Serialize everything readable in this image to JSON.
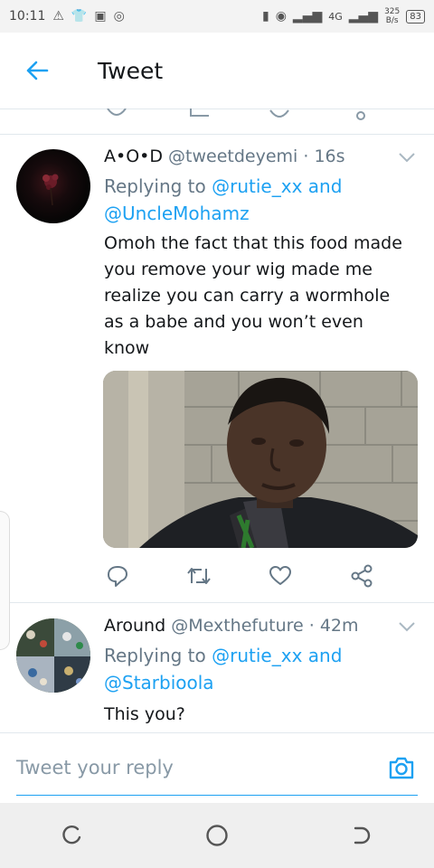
{
  "status": {
    "time": "10:11",
    "network_type": "4G",
    "speed_value": "325",
    "speed_unit": "B/s",
    "battery": "83"
  },
  "header": {
    "title": "Tweet"
  },
  "tweets": [
    {
      "name": "A•O•D",
      "handle": "@tweetdeyemi",
      "time": "· 16s",
      "replying_prefix": "Replying to",
      "reply_user1": "@rutie_xx",
      "reply_and": "and",
      "reply_user2": "@UncleMohamz",
      "text_lines": [
        "Omoh the fact that this food made",
        "you remove your wig made me",
        "realize you can carry a wormhole",
        "as a babe and you won’t even",
        "know"
      ]
    },
    {
      "name": "Around",
      "handle": "@Mexthefuture",
      "time": "· 42m",
      "replying_prefix": "Replying to",
      "reply_user1": "@rutie_xx",
      "reply_and": "and",
      "reply_user2": "@Starbioola",
      "text": "This you?"
    }
  ],
  "composer": {
    "placeholder": "Tweet your reply"
  },
  "colors": {
    "accent": "#1da1f2",
    "secondary_text": "#657786",
    "divider": "#e1e8ed"
  },
  "icons": [
    "back-arrow-icon",
    "reply-icon",
    "retweet-icon",
    "like-icon",
    "share-icon",
    "chevron-down-icon",
    "camera-icon",
    "recents-icon",
    "home-icon",
    "back-nav-icon"
  ]
}
